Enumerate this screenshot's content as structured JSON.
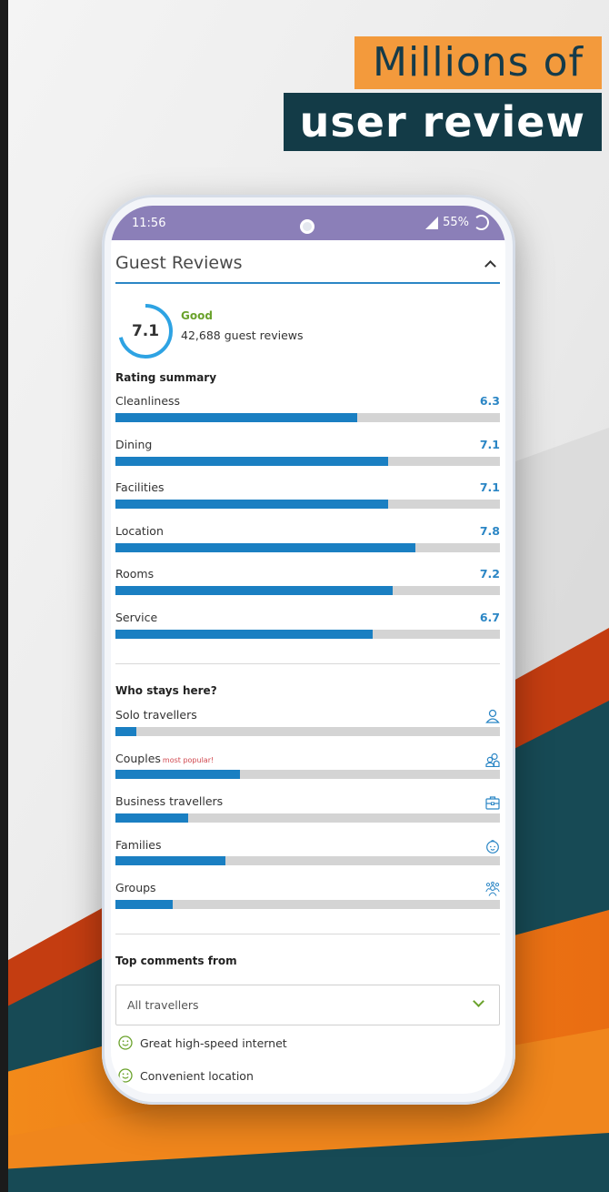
{
  "promo": {
    "line1": "Millions of",
    "line2": "user review"
  },
  "status": {
    "time": "11:56",
    "battery": "55%"
  },
  "section_title": "Guest Reviews",
  "score": {
    "value": "7.1",
    "fraction": 0.71,
    "label": "Good",
    "count": "42,688 guest reviews"
  },
  "rating_title": "Rating summary",
  "ratings": [
    {
      "label": "Cleanliness",
      "value": "6.3",
      "fraction": 0.63
    },
    {
      "label": "Dining",
      "value": "7.1",
      "fraction": 0.71
    },
    {
      "label": "Facilities",
      "value": "7.1",
      "fraction": 0.71
    },
    {
      "label": "Location",
      "value": "7.8",
      "fraction": 0.78
    },
    {
      "label": "Rooms",
      "value": "7.2",
      "fraction": 0.72
    },
    {
      "label": "Service",
      "value": "6.7",
      "fraction": 0.67
    }
  ],
  "who_title": "Who stays here?",
  "who": [
    {
      "label": "Solo travellers",
      "fraction": 0.055,
      "icon": "person-icon"
    },
    {
      "label": "Couples",
      "tag": "most popular!",
      "fraction": 0.325,
      "icon": "couple-icon"
    },
    {
      "label": "Business travellers",
      "fraction": 0.19,
      "icon": "briefcase-icon"
    },
    {
      "label": "Families",
      "fraction": 0.285,
      "icon": "baby-icon"
    },
    {
      "label": "Groups",
      "fraction": 0.15,
      "icon": "group-icon"
    }
  ],
  "comments_title": "Top comments from",
  "dropdown": {
    "selected": "All travellers"
  },
  "comments": [
    "Great high-speed internet",
    "Convenient location"
  ],
  "colors": {
    "accent": "#1a7fc2",
    "good": "#6aa22b",
    "status_bar": "#8b7fb8"
  }
}
